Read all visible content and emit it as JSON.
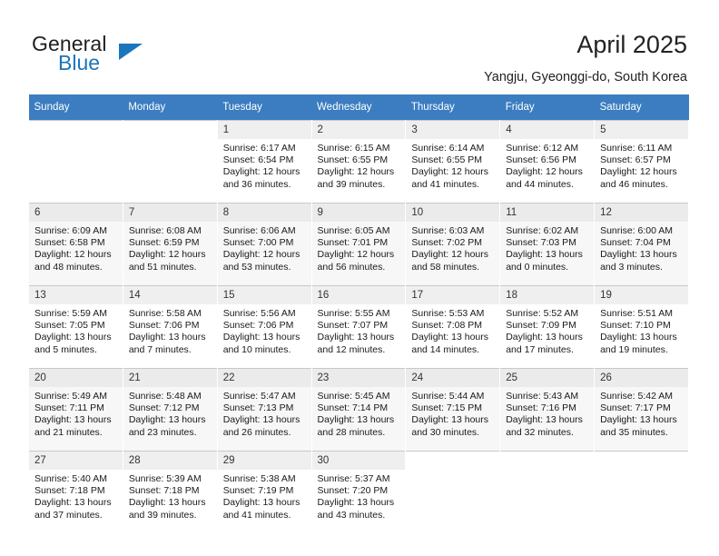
{
  "brand": {
    "name_part1": "General",
    "name_part2": "Blue",
    "accent_color": "#1b75bb"
  },
  "header": {
    "title": "April 2025",
    "subtitle": "Yangju, Gyeonggi-do, South Korea"
  },
  "calendar": {
    "header_bg": "#3b7dc0",
    "weekday_headers": [
      "Sunday",
      "Monday",
      "Tuesday",
      "Wednesday",
      "Thursday",
      "Friday",
      "Saturday"
    ],
    "weeks": [
      [
        {
          "day": "",
          "lines": []
        },
        {
          "day": "",
          "lines": []
        },
        {
          "day": "1",
          "lines": [
            "Sunrise: 6:17 AM",
            "Sunset: 6:54 PM",
            "Daylight: 12 hours",
            "and 36 minutes."
          ]
        },
        {
          "day": "2",
          "lines": [
            "Sunrise: 6:15 AM",
            "Sunset: 6:55 PM",
            "Daylight: 12 hours",
            "and 39 minutes."
          ]
        },
        {
          "day": "3",
          "lines": [
            "Sunrise: 6:14 AM",
            "Sunset: 6:55 PM",
            "Daylight: 12 hours",
            "and 41 minutes."
          ]
        },
        {
          "day": "4",
          "lines": [
            "Sunrise: 6:12 AM",
            "Sunset: 6:56 PM",
            "Daylight: 12 hours",
            "and 44 minutes."
          ]
        },
        {
          "day": "5",
          "lines": [
            "Sunrise: 6:11 AM",
            "Sunset: 6:57 PM",
            "Daylight: 12 hours",
            "and 46 minutes."
          ]
        }
      ],
      [
        {
          "day": "6",
          "lines": [
            "Sunrise: 6:09 AM",
            "Sunset: 6:58 PM",
            "Daylight: 12 hours",
            "and 48 minutes."
          ]
        },
        {
          "day": "7",
          "lines": [
            "Sunrise: 6:08 AM",
            "Sunset: 6:59 PM",
            "Daylight: 12 hours",
            "and 51 minutes."
          ]
        },
        {
          "day": "8",
          "lines": [
            "Sunrise: 6:06 AM",
            "Sunset: 7:00 PM",
            "Daylight: 12 hours",
            "and 53 minutes."
          ]
        },
        {
          "day": "9",
          "lines": [
            "Sunrise: 6:05 AM",
            "Sunset: 7:01 PM",
            "Daylight: 12 hours",
            "and 56 minutes."
          ]
        },
        {
          "day": "10",
          "lines": [
            "Sunrise: 6:03 AM",
            "Sunset: 7:02 PM",
            "Daylight: 12 hours",
            "and 58 minutes."
          ]
        },
        {
          "day": "11",
          "lines": [
            "Sunrise: 6:02 AM",
            "Sunset: 7:03 PM",
            "Daylight: 13 hours",
            "and 0 minutes."
          ]
        },
        {
          "day": "12",
          "lines": [
            "Sunrise: 6:00 AM",
            "Sunset: 7:04 PM",
            "Daylight: 13 hours",
            "and 3 minutes."
          ]
        }
      ],
      [
        {
          "day": "13",
          "lines": [
            "Sunrise: 5:59 AM",
            "Sunset: 7:05 PM",
            "Daylight: 13 hours",
            "and 5 minutes."
          ]
        },
        {
          "day": "14",
          "lines": [
            "Sunrise: 5:58 AM",
            "Sunset: 7:06 PM",
            "Daylight: 13 hours",
            "and 7 minutes."
          ]
        },
        {
          "day": "15",
          "lines": [
            "Sunrise: 5:56 AM",
            "Sunset: 7:06 PM",
            "Daylight: 13 hours",
            "and 10 minutes."
          ]
        },
        {
          "day": "16",
          "lines": [
            "Sunrise: 5:55 AM",
            "Sunset: 7:07 PM",
            "Daylight: 13 hours",
            "and 12 minutes."
          ]
        },
        {
          "day": "17",
          "lines": [
            "Sunrise: 5:53 AM",
            "Sunset: 7:08 PM",
            "Daylight: 13 hours",
            "and 14 minutes."
          ]
        },
        {
          "day": "18",
          "lines": [
            "Sunrise: 5:52 AM",
            "Sunset: 7:09 PM",
            "Daylight: 13 hours",
            "and 17 minutes."
          ]
        },
        {
          "day": "19",
          "lines": [
            "Sunrise: 5:51 AM",
            "Sunset: 7:10 PM",
            "Daylight: 13 hours",
            "and 19 minutes."
          ]
        }
      ],
      [
        {
          "day": "20",
          "lines": [
            "Sunrise: 5:49 AM",
            "Sunset: 7:11 PM",
            "Daylight: 13 hours",
            "and 21 minutes."
          ]
        },
        {
          "day": "21",
          "lines": [
            "Sunrise: 5:48 AM",
            "Sunset: 7:12 PM",
            "Daylight: 13 hours",
            "and 23 minutes."
          ]
        },
        {
          "day": "22",
          "lines": [
            "Sunrise: 5:47 AM",
            "Sunset: 7:13 PM",
            "Daylight: 13 hours",
            "and 26 minutes."
          ]
        },
        {
          "day": "23",
          "lines": [
            "Sunrise: 5:45 AM",
            "Sunset: 7:14 PM",
            "Daylight: 13 hours",
            "and 28 minutes."
          ]
        },
        {
          "day": "24",
          "lines": [
            "Sunrise: 5:44 AM",
            "Sunset: 7:15 PM",
            "Daylight: 13 hours",
            "and 30 minutes."
          ]
        },
        {
          "day": "25",
          "lines": [
            "Sunrise: 5:43 AM",
            "Sunset: 7:16 PM",
            "Daylight: 13 hours",
            "and 32 minutes."
          ]
        },
        {
          "day": "26",
          "lines": [
            "Sunrise: 5:42 AM",
            "Sunset: 7:17 PM",
            "Daylight: 13 hours",
            "and 35 minutes."
          ]
        }
      ],
      [
        {
          "day": "27",
          "lines": [
            "Sunrise: 5:40 AM",
            "Sunset: 7:18 PM",
            "Daylight: 13 hours",
            "and 37 minutes."
          ]
        },
        {
          "day": "28",
          "lines": [
            "Sunrise: 5:39 AM",
            "Sunset: 7:18 PM",
            "Daylight: 13 hours",
            "and 39 minutes."
          ]
        },
        {
          "day": "29",
          "lines": [
            "Sunrise: 5:38 AM",
            "Sunset: 7:19 PM",
            "Daylight: 13 hours",
            "and 41 minutes."
          ]
        },
        {
          "day": "30",
          "lines": [
            "Sunrise: 5:37 AM",
            "Sunset: 7:20 PM",
            "Daylight: 13 hours",
            "and 43 minutes."
          ]
        },
        {
          "day": "",
          "lines": []
        },
        {
          "day": "",
          "lines": []
        },
        {
          "day": "",
          "lines": []
        }
      ]
    ]
  }
}
